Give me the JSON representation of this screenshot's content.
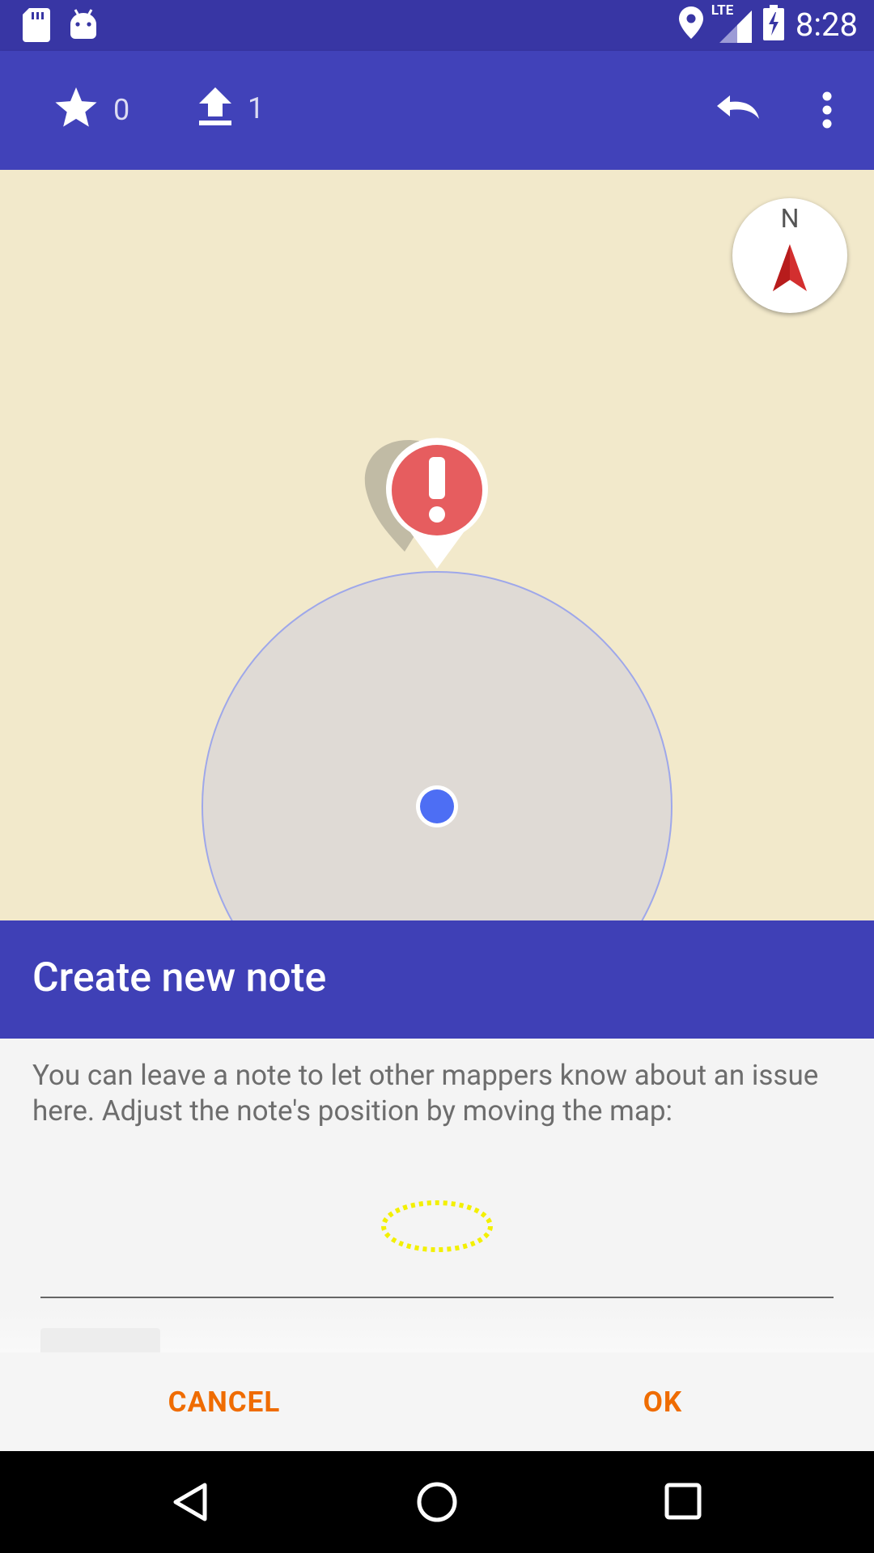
{
  "status_bar": {
    "time": "8:28",
    "network": "LTE",
    "icons": [
      "sd-card-icon",
      "android-icon",
      "location-icon",
      "signal-icon",
      "battery-charging-icon"
    ]
  },
  "toolbar": {
    "starred_count": "0",
    "upload_count": "1",
    "icons": [
      "star-icon",
      "upload-icon",
      "undo-icon",
      "more-vert-icon"
    ]
  },
  "map": {
    "compass_label": "N",
    "marker": "note-marker-icon",
    "colors": {
      "map_background": "#f2e9cb",
      "accuracy_circle": "#dfdad5",
      "location_dot": "#4d6ef4",
      "marker": "#e65d5f",
      "compass_needle": "#d32f2f"
    }
  },
  "dialog": {
    "title": "Create new note",
    "message": "You can leave a note to let other mappers know about an issue here. Adjust the note's position by moving the map:",
    "note_text": "",
    "cancel_label": "CANCEL",
    "ok_label": "OK",
    "accent_color": "#ef6c00"
  },
  "nav_bar": {
    "icons": [
      "back-icon",
      "home-icon",
      "recents-icon"
    ]
  }
}
